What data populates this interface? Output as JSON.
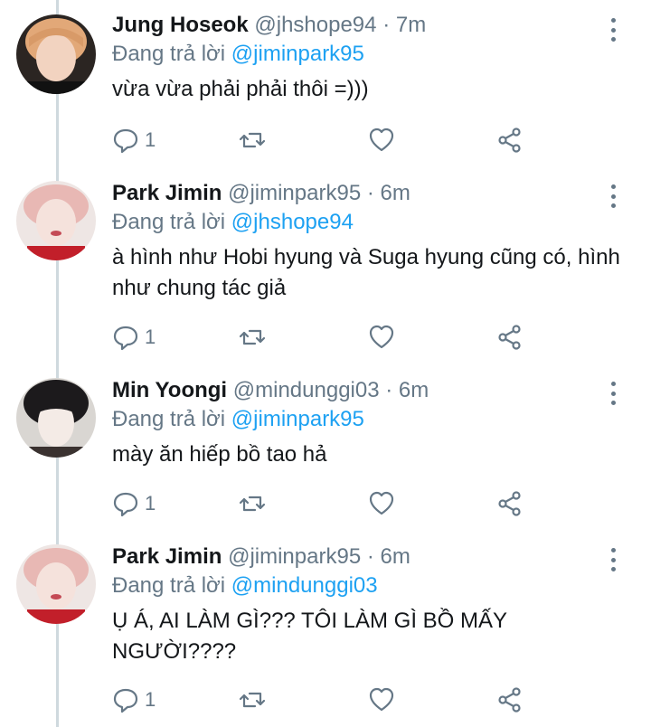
{
  "tweets": [
    {
      "name": "Jung Hoseok",
      "handle": "@jhshope94",
      "time": "· 7m",
      "reply_prefix": "Đang trả lời",
      "reply_to": "@jiminpark95",
      "text": "vừa vừa phải phải thôi =)))",
      "reply_count": "1"
    },
    {
      "name": "Park Jimin",
      "handle": "@jiminpark95",
      "time": "· 6m",
      "reply_prefix": "Đang trả lời",
      "reply_to": "@jhshope94",
      "text": "à hình như Hobi hyung và Suga hyung cũng có, hình như chung tác giả",
      "reply_count": "1"
    },
    {
      "name": "Min Yoongi",
      "handle": "@mindunggi03",
      "time": "· 6m",
      "reply_prefix": "Đang trả lời",
      "reply_to": "@jiminpark95",
      "text": "mày ăn hiếp bồ tao hả",
      "reply_count": "1"
    },
    {
      "name": "Park Jimin",
      "handle": "@jiminpark95",
      "time": "· 6m",
      "reply_prefix": "Đang trả lời",
      "reply_to": "@mindunggi03",
      "text": "Ụ Á, AI LÀM GÌ??? TÔI LÀM GÌ BỒ MẤY NGƯỜI????",
      "reply_count": "1"
    }
  ],
  "icons": {
    "reply": "reply-icon",
    "retweet": "retweet-icon",
    "like": "heart-icon",
    "share": "share-icon",
    "more": "more-vertical-icon"
  },
  "colors": {
    "mention": "#1da1f2",
    "secondary_text": "#657786",
    "thread_line": "#cfd9de"
  }
}
